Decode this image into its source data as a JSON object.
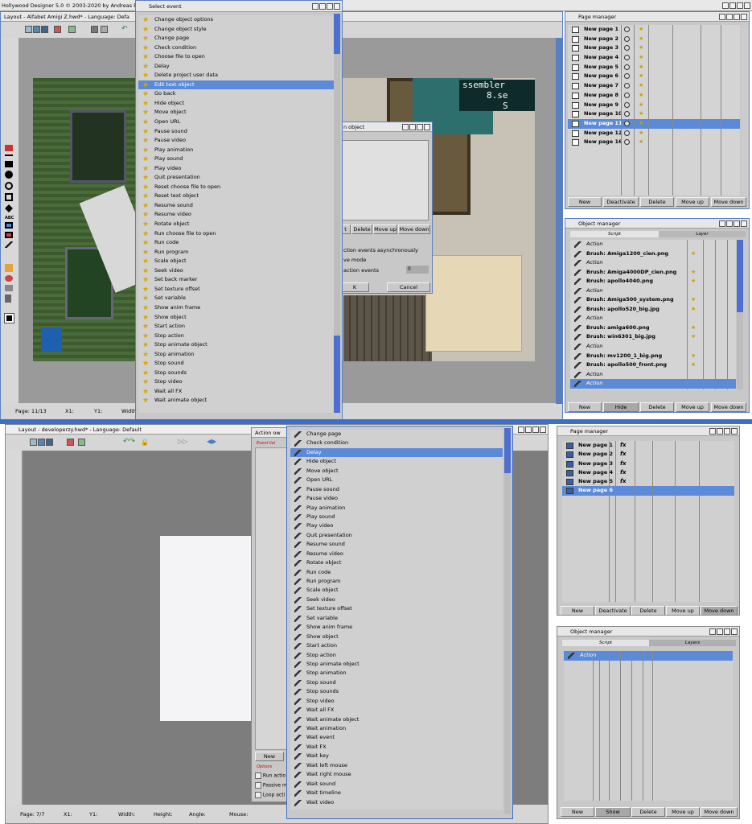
{
  "top_window": {
    "title": "Hollywood Designer 5.0 © 2003-2020 by Andreas F",
    "layout_title": "Layout - Alfabet Amigi Z.hwd* - Language: Defa",
    "status": {
      "page": "Page: 11/13",
      "x": "X1:",
      "y": "Y1:",
      "width": "Width"
    }
  },
  "select_event": {
    "title": "Select event",
    "items": [
      "Change object options",
      "Change object style",
      "Change page",
      "Check condition",
      "Choose file to open",
      "Delay",
      "Delete project user data",
      "Edit text object",
      "Go back",
      "Hide object",
      "Move object",
      "Open URL",
      "Pause sound",
      "Pause video",
      "Play animation",
      "Play sound",
      "Play video",
      "Quit presentation",
      "Reset choose file to open",
      "Reset text object",
      "Resume sound",
      "Resume video",
      "Rotate object",
      "Run choose file to open",
      "Run code",
      "Run program",
      "Scale object",
      "Seek video",
      "Set back marker",
      "Set texture offset",
      "Set variable",
      "Show anim frame",
      "Show object",
      "Start action",
      "Stop action",
      "Stop animate object",
      "Stop animation",
      "Stop sound",
      "Stop sounds",
      "Stop video",
      "Wait all FX",
      "Wait animate object"
    ],
    "selected_index": 7
  },
  "edit_object_dialog": {
    "title": "n object",
    "buttons": [
      "t",
      "Delete",
      "Move up",
      "Move down"
    ],
    "async_label": "ction events asynchronously",
    "mode_label": "ve mode",
    "events_label": "action events",
    "events_value": "0",
    "ok": "K",
    "cancel": "Cancel"
  },
  "screen_text": {
    "line1": "ssembler",
    "line2": "8.se",
    "line3": "S"
  },
  "page_manager_top": {
    "title": "Page manager",
    "pages": [
      "New page 1",
      "New page 2",
      "New page 3",
      "New page 4",
      "New page 5",
      "New page 6",
      "New page 7",
      "New page 8",
      "New page 9",
      "New page 10",
      "New page 11",
      "New page 12",
      "New page 16"
    ],
    "selected_index": 10,
    "buttons": [
      "New",
      "Deactivate",
      "Delete",
      "Move up",
      "Move down"
    ]
  },
  "object_manager_top": {
    "title": "Object manager",
    "tabs": [
      "Script",
      "Layer"
    ],
    "items": [
      "Action",
      "Brush: Amiga1200_cien.png",
      "Action",
      "Brush: Amiga4000DP_cien.png",
      "Brush: apollo4040.png",
      "Action",
      "Brush: Amiga500_system.png",
      "Brush: apollo520_big.jpg",
      "Action",
      "Brush: amiga600.png",
      "Brush: win6301_big.jpg",
      "Action",
      "Brush: mv1200_1_big.png",
      "Brush: apollo500_front.png",
      "Action",
      "Action"
    ],
    "selected_index": 15,
    "buttons": [
      "New",
      "Hide",
      "Delete",
      "Move up",
      "Move down"
    ]
  },
  "bottom_layout": {
    "title": "Layout - developerzy.hwd* - Language: Default",
    "status": {
      "page": "Page: 7/7",
      "x": "X1:",
      "y": "Y1:",
      "width": "Width:",
      "height": "Height:",
      "angle": "Angle:",
      "mouse": "Mouse:"
    }
  },
  "action_window": {
    "title": "Action ow",
    "event_list_label": "Event list",
    "new_button": "New",
    "options_label": "Options",
    "checkboxes": [
      "Run actio",
      "Passive m",
      "Loop acti"
    ]
  },
  "event_list_bottom": {
    "items": [
      "Change page",
      "Check condition",
      "Delay",
      "Hide object",
      "Move object",
      "Open URL",
      "Pause sound",
      "Pause video",
      "Play animation",
      "Play sound",
      "Play video",
      "Quit presentation",
      "Resume sound",
      "Resume video",
      "Rotate object",
      "Run code",
      "Run program",
      "Scale object",
      "Seek video",
      "Set texture offset",
      "Set variable",
      "Show anim frame",
      "Show object",
      "Start action",
      "Stop action",
      "Stop animate object",
      "Stop animation",
      "Stop sound",
      "Stop sounds",
      "Stop video",
      "Wait all FX",
      "Wait animate object",
      "Wait animation",
      "Wait event",
      "Wait FX",
      "Wait key",
      "Wait left mouse",
      "Wait right mouse",
      "Wait sound",
      "Wait timeline",
      "Wait video"
    ],
    "selected_index": 2
  },
  "page_manager_bottom": {
    "title": "Page manager",
    "pages": [
      "New page 1",
      "New page 2",
      "New page 3",
      "New page 4",
      "New page 5",
      "New page 6"
    ],
    "selected_index": 5,
    "buttons": [
      "New",
      "Deactivate",
      "Delete",
      "Move up",
      "Move down"
    ]
  },
  "object_manager_bottom": {
    "title": "Object manager",
    "tabs": [
      "Script",
      "Layers"
    ],
    "items": [
      "Action"
    ],
    "buttons": [
      "New",
      "Show",
      "Delete",
      "Move up",
      "Move down"
    ]
  },
  "colors": {
    "selection": "#5b8bd8",
    "frame": "#5a7fbf",
    "panel": "#c8c8c8"
  }
}
